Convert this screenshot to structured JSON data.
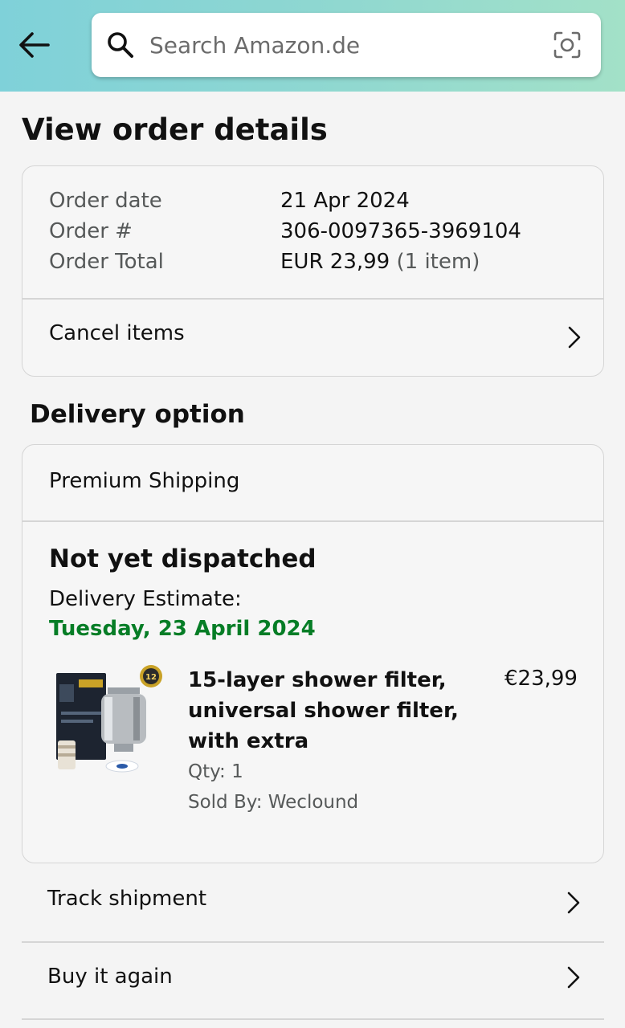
{
  "header": {
    "back_icon": "arrow-left-icon",
    "search_placeholder": "Search Amazon.de",
    "search_value": "",
    "search_icon": "search-icon",
    "camera_icon": "camera-lens-icon"
  },
  "page_title": "View order details",
  "order_summary": {
    "rows": [
      {
        "label": "Order date",
        "value": "21 Apr 2024",
        "extra": ""
      },
      {
        "label": "Order #",
        "value": "306-0097365-3969104",
        "extra": ""
      },
      {
        "label": "Order Total",
        "value": "EUR 23,99",
        "extra": "(1 item)"
      }
    ],
    "cancel_label": "Cancel items"
  },
  "delivery": {
    "section_title": "Delivery option",
    "shipping_method": "Premium Shipping",
    "status": "Not yet dispatched",
    "estimate_label": "Delivery Estimate:",
    "estimate_date": "Tuesday, 23 April 2024",
    "estimate_color": "#067d26",
    "item": {
      "title_lines": [
        "15-layer shower filter,",
        "universal shower filter,",
        "with extra"
      ],
      "price": "€23,99",
      "qty": "Qty: 1",
      "seller": "Sold By: Weclound",
      "badge_text": "12 STAGE"
    }
  },
  "actions": {
    "track": "Track shipment",
    "buy_again": "Buy it again"
  }
}
